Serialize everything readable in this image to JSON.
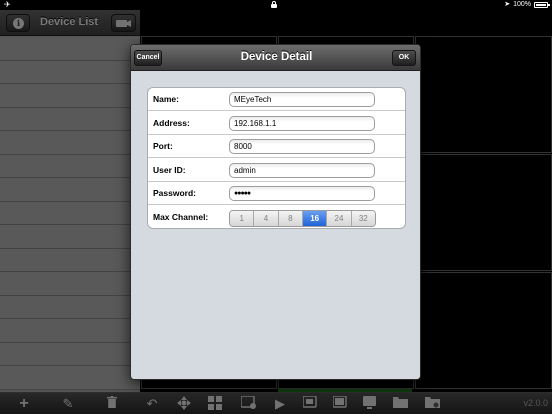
{
  "status_bar": {
    "battery": "100%"
  },
  "sidebar": {
    "title": "Device List"
  },
  "toolbar": {
    "version": "v2.0.0"
  },
  "modal": {
    "title": "Device Detail",
    "cancel_label": "Cancel",
    "ok_label": "OK",
    "fields": {
      "name": {
        "label": "Name:",
        "value": "MEyeTech"
      },
      "address": {
        "label": "Address:",
        "value": "192.168.1.1"
      },
      "port": {
        "label": "Port:",
        "value": "8000"
      },
      "user_id": {
        "label": "User ID:",
        "value": "admin"
      },
      "password": {
        "label": "Password:",
        "value": "●●●●●"
      }
    },
    "max_channel": {
      "label": "Max Channel:",
      "options": [
        "1",
        "4",
        "8",
        "16",
        "24",
        "32"
      ],
      "selected": "16"
    }
  },
  "colors": {
    "accent": "#2a6fe0",
    "toolbar": "#3a3a3a"
  }
}
